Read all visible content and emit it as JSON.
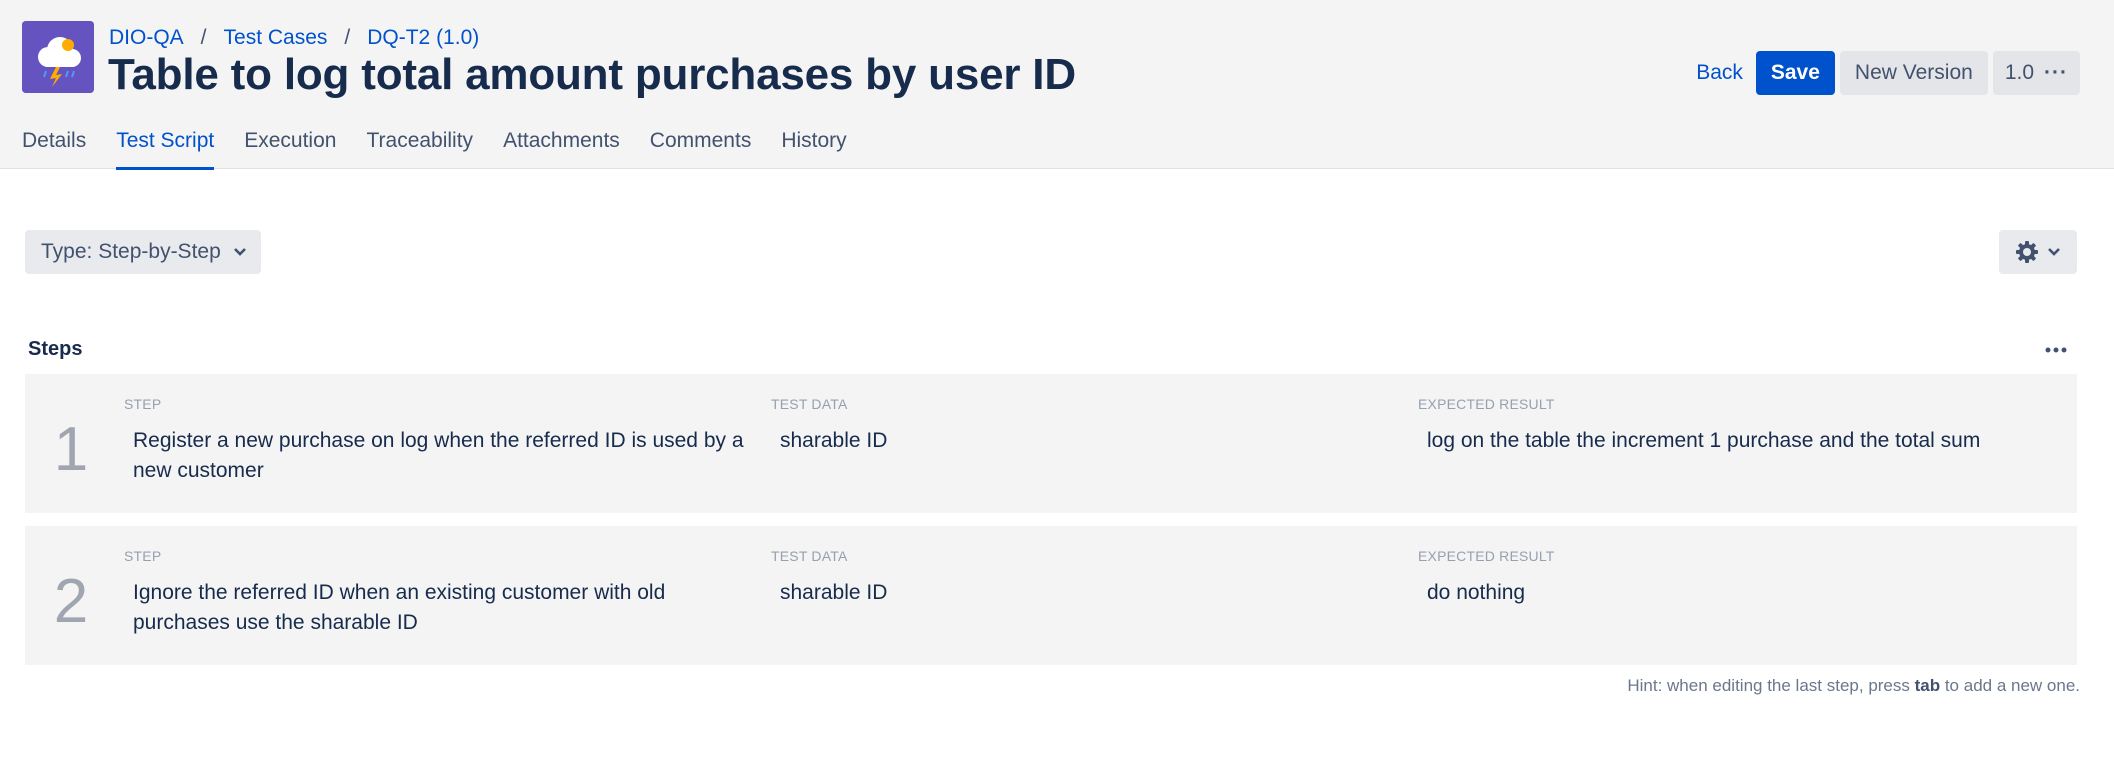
{
  "breadcrumb": [
    {
      "label": "DIO-QA"
    },
    {
      "label": "Test Cases"
    },
    {
      "label": "DQ-T2 (1.0)"
    }
  ],
  "breadcrumb_separator": "/",
  "page_title": "Table to log total amount purchases by user ID",
  "actions": {
    "back_label": "Back",
    "save_label": "Save",
    "new_version_label": "New Version",
    "version_label": "1.0",
    "more_label": "···"
  },
  "tabs": [
    {
      "label": "Details",
      "active": false
    },
    {
      "label": "Test Script",
      "active": true
    },
    {
      "label": "Execution",
      "active": false
    },
    {
      "label": "Traceability",
      "active": false
    },
    {
      "label": "Attachments",
      "active": false
    },
    {
      "label": "Comments",
      "active": false
    },
    {
      "label": "History",
      "active": false
    }
  ],
  "type_select": {
    "label": "Type: Step-by-Step"
  },
  "steps": {
    "title": "Steps",
    "column_labels": {
      "step": "STEP",
      "test_data": "TEST DATA",
      "expected_result": "EXPECTED RESULT"
    },
    "rows": [
      {
        "number": "1",
        "step": "Register a new purchase on log when the referred ID is used by a new customer",
        "test_data": "sharable ID",
        "expected_result": "log on the table the increment 1 purchase and the total sum"
      },
      {
        "number": "2",
        "step": "Ignore the referred ID when an existing customer with old purchases use the sharable ID",
        "test_data": "sharable ID",
        "expected_result": "do nothing"
      }
    ]
  },
  "hint": {
    "prefix": "Hint: when editing the last step, press ",
    "key": "tab",
    "suffix": " to add a new one."
  },
  "icons": {
    "project": "cloud-lightning-icon",
    "type_chevron": "chevron-down-icon",
    "settings": "gear-icon",
    "settings_chevron": "chevron-down-icon",
    "steps_more": "more-horizontal-icon"
  },
  "colors": {
    "primary": "#0052cc",
    "project_icon_bg": "#6554c0",
    "header_bg": "#f4f4f4",
    "text_dark": "#172b4d"
  }
}
